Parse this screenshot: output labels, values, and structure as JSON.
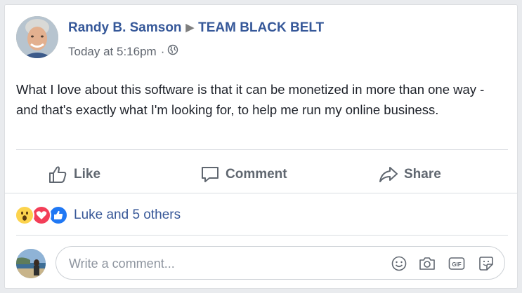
{
  "post": {
    "author": "Randy B. Samson",
    "group": "TEAM BLACK BELT",
    "time": "Today at 5:16pm",
    "privacy_separator": "·",
    "text": "What I love about this software is that it can be monetized in more than one way - and that's exactly what I'm looking for, to help me run my online business."
  },
  "actions": {
    "like": "Like",
    "comment": "Comment",
    "share": "Share"
  },
  "reactions": {
    "icons": [
      "wow-icon",
      "love-icon",
      "like-icon"
    ],
    "summary": "Luke and 5 others"
  },
  "comment_box": {
    "placeholder": "Write a comment..."
  },
  "colors": {
    "link": "#365899",
    "action_text": "#606770",
    "like_blue": "#2078f4",
    "love_red": "#f33e58",
    "wow_yellow": "#fcd34d"
  }
}
